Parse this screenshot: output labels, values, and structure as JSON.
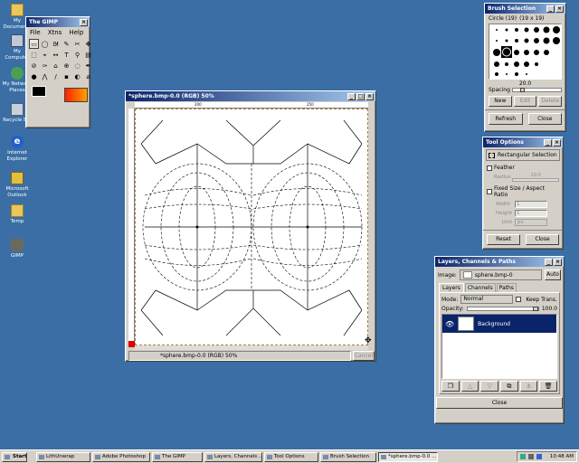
{
  "desktop": {
    "icons": [
      {
        "label": "My Documents",
        "icon": "folder-icon"
      },
      {
        "label": "My Computer",
        "icon": "computer-icon"
      },
      {
        "label": "My Network Places",
        "icon": "network-icon"
      },
      {
        "label": "Recycle Bin",
        "icon": "recycle-bin-icon"
      },
      {
        "label": "Internet Explorer",
        "icon": "ie-icon"
      },
      {
        "label": "Microsoft Outlook",
        "icon": "outlook-icon"
      },
      {
        "label": "Temp",
        "icon": "folder-icon"
      },
      {
        "label": "GIMP",
        "icon": "gimp-icon"
      }
    ]
  },
  "toolbox": {
    "title": "The GIMP",
    "menu": [
      "File",
      "Xtns",
      "Help"
    ],
    "tools": [
      "▭",
      "◯",
      "ᘛ",
      "✎",
      "✂",
      "✥",
      "⬚",
      "⌖",
      "↔",
      "T",
      "⚲",
      "▤",
      "⊘",
      "✑",
      "⌂",
      "⊕",
      "◌",
      "✒",
      "●",
      "⋀",
      "/",
      "▪",
      "◐",
      "⌀"
    ]
  },
  "image_window": {
    "title": "*sphere.bmp-0.0 (RGB) 50%",
    "status": "*sphere.bmp-0.0 (RGB) 50%",
    "cancel_label": "Cancel",
    "ruler_ticks": [
      "200",
      "250"
    ]
  },
  "brush_window": {
    "title": "Brush Selection",
    "brush_name": "Circle (19)",
    "brush_size": "(19 x 19)",
    "spacing_label": "Spacing",
    "spacing_value": "20.0",
    "new_label": "New",
    "edit_label": "Edit",
    "delete_label": "Delete",
    "refresh_label": "Refresh",
    "close_label": "Close"
  },
  "tool_options": {
    "title": "Tool Options",
    "tool_name": "Rectangular Selection",
    "feather_label": "Feather",
    "radius_label": "Radius",
    "radius_value": "10.0",
    "fixed_label": "Fixed Size / Aspect Ratio",
    "width_label": "Width",
    "width_value": "1",
    "height_label": "Height",
    "height_value": "1",
    "unit_label": "Unit",
    "unit_value": "px",
    "reset_label": "Reset",
    "close_label": "Close"
  },
  "layers": {
    "title": "Layers, Channels & Paths",
    "image_label": "Image:",
    "image_value": "sphere.bmp-0",
    "auto_label": "Auto",
    "tabs": [
      "Layers",
      "Channels",
      "Paths"
    ],
    "mode_label": "Mode:",
    "mode_value": "Normal",
    "keep_trans_label": "Keep Trans.",
    "opacity_label": "Opacity:",
    "opacity_value": "100.0",
    "layer_name": "Background",
    "close_label": "Close"
  },
  "taskbar": {
    "start_label": "Start",
    "items": [
      "LithUnwrap",
      "Adobe Photoshop",
      "The GIMP",
      "Layers, Channels ...",
      "Tool Options",
      "Brush Selection",
      "*sphere.bmp-0.0 ..."
    ],
    "active_index": 6,
    "clock": "10:48 AM"
  },
  "colors": {
    "desktop": "#3a6ea5",
    "title_active": "#0a246a",
    "selection": "#0a246a"
  }
}
